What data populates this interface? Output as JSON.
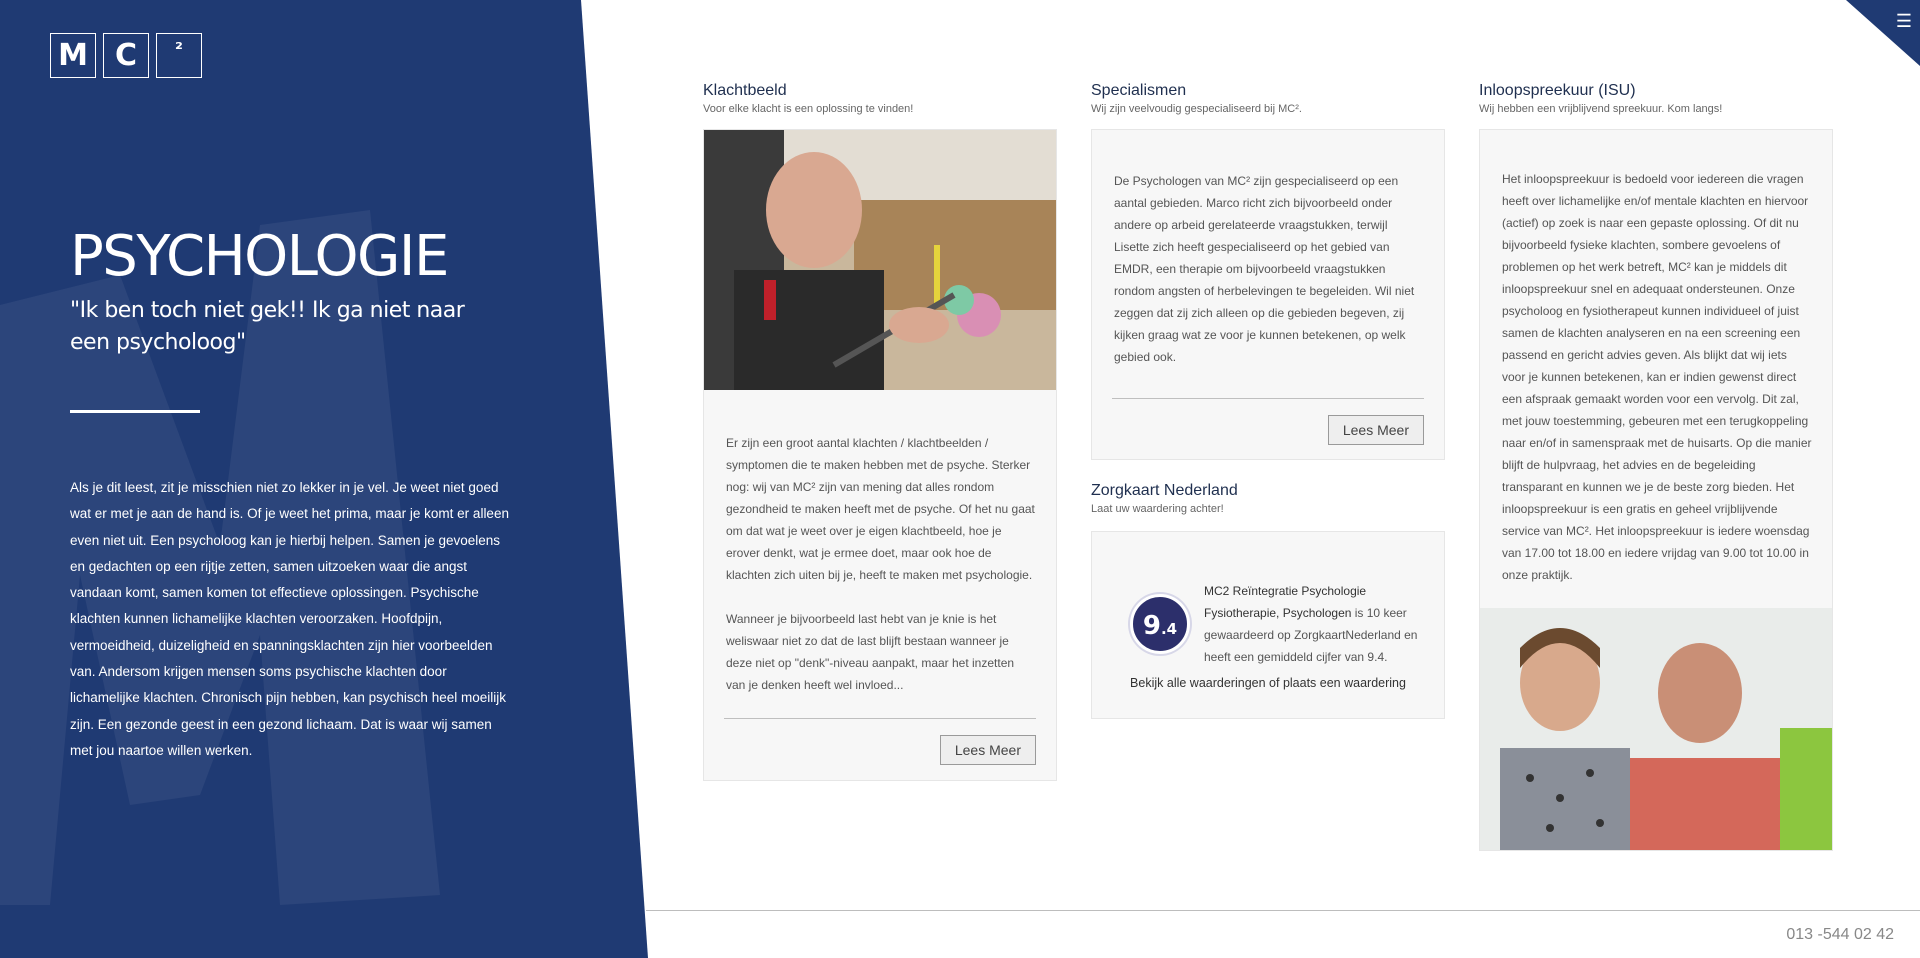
{
  "logo": {
    "letters": [
      "M",
      "C",
      "²"
    ]
  },
  "hero": {
    "title": "PSYCHOLOGIE",
    "quote": "\"Ik ben toch niet gek!! Ik ga niet naar een psycholoog\"",
    "text": "Als je dit leest, zit je misschien niet zo lekker in je vel. Je weet niet goed wat er met je aan de hand is. Of je weet het prima, maar je komt er alleen even niet uit. Een psycholoog kan je hierbij helpen. Samen je gevoelens en gedachten op een rijtje zetten, samen uitzoeken waar die angst vandaan komt, samen komen tot effectieve oplossingen. Psychische klachten kunnen lichamelijke klachten veroorzaken. Hoofdpijn, vermoeidheid, duizeligheid en spanningsklachten zijn hier voorbeelden van. Andersom krijgen mensen soms psychische klachten door lichamelijke klachten. Chronisch pijn hebben, kan psychisch heel moeilijk zijn. Een gezonde geest in een gezond lichaam. Dat is waar wij samen met jou naartoe willen werken."
  },
  "menu": {
    "icon": "hamburger-icon",
    "glyph": "☰"
  },
  "klachtbeeld": {
    "title": "Klachtbeeld",
    "subtitle": "Voor elke klacht is een oplossing te vinden!",
    "p1": "Er zijn een groot aantal klachten / klachtbeelden / symptomen die te maken hebben met de psyche. Sterker nog: wij van MC² zijn van mening dat alles rondom gezondheid te maken heeft met de psyche. Of het nu gaat om dat wat je weet over je eigen klachtbeeld, hoe je erover denkt, wat je ermee doet, maar ook hoe de klachten zich uiten bij je, heeft te maken met psychologie.",
    "p2": "Wanneer je bijvoorbeeld last hebt van je knie is het weliswaar niet zo dat de last blijft bestaan wanneer je deze niet op \"denk\"-niveau aanpakt, maar het inzetten van je denken heeft wel invloed...",
    "button": "Lees Meer"
  },
  "specialismen": {
    "title": "Specialismen",
    "subtitle": "Wij zijn veelvoudig gespecialiseerd bij MC².",
    "p1": "De Psychologen van MC² zijn gespecialiseerd op een aantal gebieden. Marco richt zich bijvoorbeeld onder andere op arbeid gerelateerde vraagstukken, terwijl Lisette zich heeft gespecialiseerd op het gebied van EMDR, een therapie om bijvoorbeeld vraagstukken rondom angsten of herbelevingen te begeleiden. Wil niet zeggen dat zij zich alleen op die gebieden begeven, zij kijken graag wat ze voor je kunnen betekenen, op welk gebied ook.",
    "button": "Lees Meer"
  },
  "zorgkaart": {
    "title": "Zorgkaart Nederland",
    "subtitle": "Laat uw waardering achter!",
    "score_int": "9",
    "score_dec": ".4",
    "org": "MC2 Reïntegratie Psychologie Fysiotherapie, Psychologen",
    "text": " is 10 keer gewaardeerd op ZorgkaartNederland en heeft een gemiddeld cijfer van 9.4.",
    "link_pre": "Bekijk ",
    "link_reviews": "alle waarderingen",
    "link_mid": " of ",
    "link_place": "plaats een waardering"
  },
  "inloop": {
    "title": "Inloopspreekuur (ISU)",
    "subtitle": "Wij hebben een vrijblijvend spreekuur. Kom langs!",
    "p1": "Het inloopspreekuur is bedoeld voor iedereen die vragen heeft over lichamelijke en/of mentale klachten en hiervoor (actief) op zoek is naar een gepaste oplossing. Of dit nu bijvoorbeeld fysieke klachten, sombere gevoelens of problemen op het werk betreft, MC² kan je middels dit inloopspreekuur snel en adequaat ondersteunen. Onze psycholoog en fysiotherapeut kunnen individueel of juist samen de klachten analyseren en na een screening een passend en gericht advies geven. Als blijkt dat wij iets voor je kunnen betekenen, kan er indien gewenst direct een afspraak gemaakt worden voor een vervolg. Dit zal, met jouw toestemming, gebeuren met een terugkoppeling naar en/of in samenspraak met de huisarts. Op die manier blijft de hulpvraag, het advies en de begeleiding transparant en kunnen we je de beste zorg bieden. Het inloopspreekuur is een gratis en geheel vrijblijvende service van MC². Het inloopspreekuur is iedere woensdag van 17.00 tot 18.00 en iedere vrijdag van 9.00 tot 10.00 in onze praktijk."
  },
  "footer": {
    "phone": "013 -544 02 42"
  },
  "colors": {
    "brand_blue": "#1f3a73",
    "badge": "#2c2f6b"
  }
}
